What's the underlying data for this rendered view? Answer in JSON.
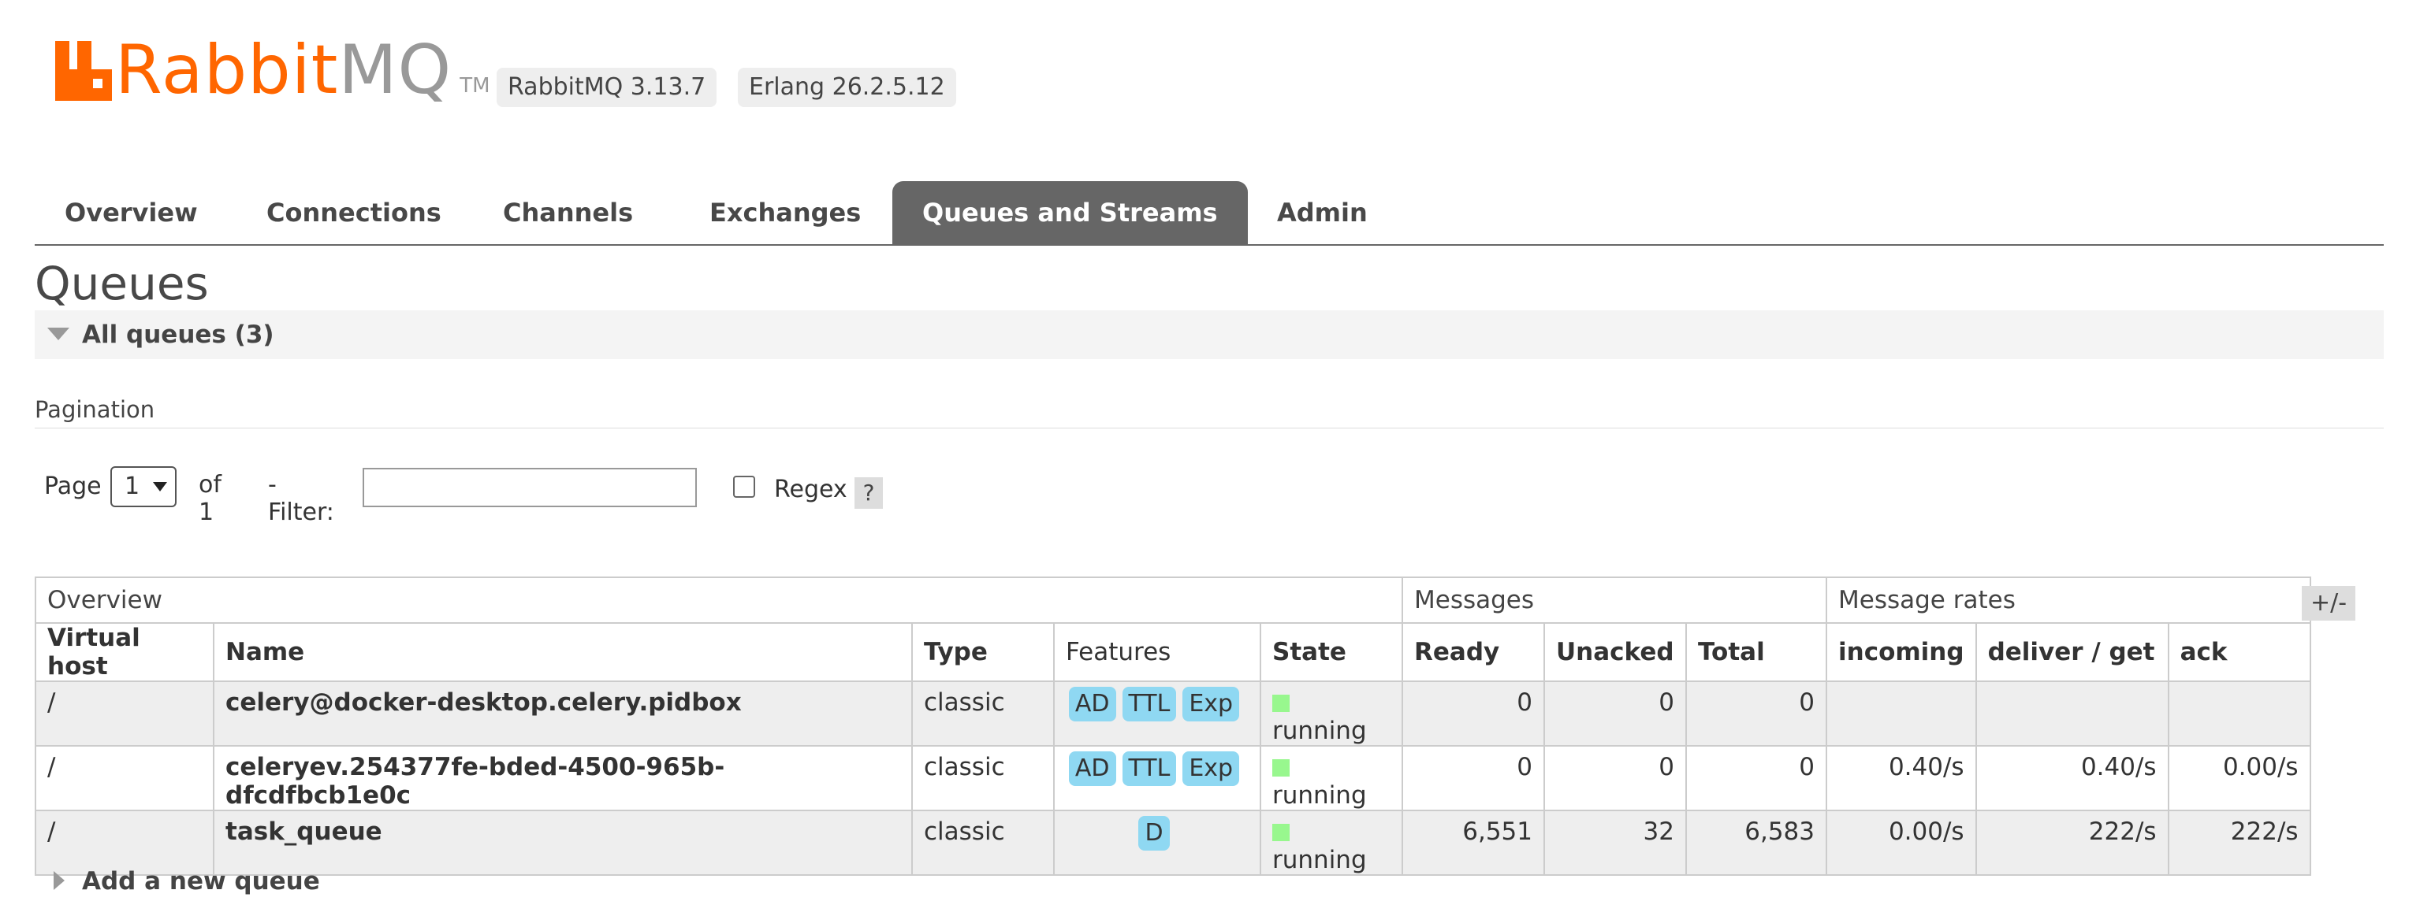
{
  "header": {
    "logo_primary": "Rabbit",
    "logo_secondary": "MQ",
    "logo_tm": "TM",
    "version": "RabbitMQ 3.13.7",
    "erlang": "Erlang 26.2.5.12",
    "brand_color": "#ff6600"
  },
  "tabs": [
    {
      "label": "Overview"
    },
    {
      "label": "Connections"
    },
    {
      "label": "Channels"
    },
    {
      "label": "Exchanges"
    },
    {
      "label": "Queues and Streams",
      "active": true
    },
    {
      "label": "Admin"
    }
  ],
  "page_title": "Queues",
  "section": {
    "label": "All queues (3)"
  },
  "pagination": {
    "title": "Pagination",
    "page_label": "Page",
    "page_value": "1",
    "of_label": "of 1",
    "filter_label": "- Filter:",
    "filter_value": "",
    "regex_label": "Regex",
    "regex_checked": false,
    "help_label": "?"
  },
  "table": {
    "groups": [
      "Overview",
      "Messages",
      "Message rates"
    ],
    "columns": [
      "Virtual host",
      "Name",
      "Type",
      "Features",
      "State",
      "Ready",
      "Unacked",
      "Total",
      "incoming",
      "deliver / get",
      "ack"
    ],
    "toggle_label": "+/-",
    "rows": [
      {
        "vhost": "/",
        "name": "celery@docker-desktop.celery.pidbox",
        "type": "classic",
        "features": [
          "AD",
          "TTL",
          "Exp"
        ],
        "state": "running",
        "ready": "0",
        "unacked": "0",
        "total": "0",
        "incoming": "",
        "deliver": "",
        "ack": ""
      },
      {
        "vhost": "/",
        "name": "celeryev.254377fe-bded-4500-965b-dfcdfbcb1e0c",
        "type": "classic",
        "features": [
          "AD",
          "TTL",
          "Exp"
        ],
        "state": "running",
        "ready": "0",
        "unacked": "0",
        "total": "0",
        "incoming": "0.40/s",
        "deliver": "0.40/s",
        "ack": "0.00/s"
      },
      {
        "vhost": "/",
        "name": "task_queue",
        "type": "classic",
        "features": [
          "D"
        ],
        "state": "running",
        "ready": "6,551",
        "unacked": "32",
        "total": "6,583",
        "incoming": "0.00/s",
        "deliver": "222/s",
        "ack": "222/s"
      }
    ]
  },
  "add_queue": {
    "label": "Add a new queue"
  }
}
